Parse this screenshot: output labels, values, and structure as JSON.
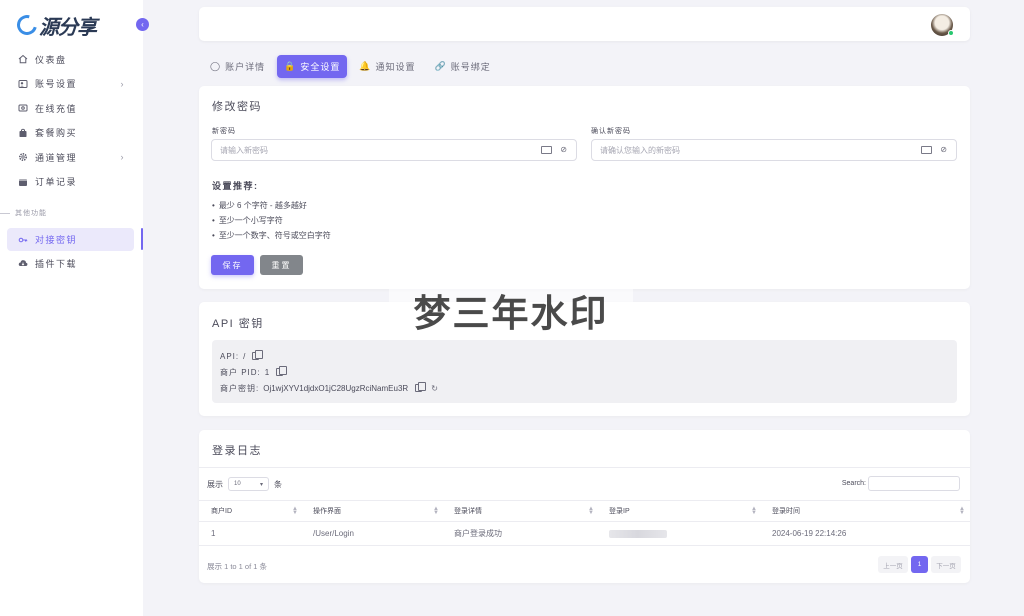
{
  "brand": {
    "logo_text": "源分享"
  },
  "sidebar": {
    "items": [
      {
        "label": "仪表盘",
        "icon": "home-icon"
      },
      {
        "label": "账号设置",
        "icon": "user-card-icon",
        "has_submenu": true
      },
      {
        "label": "在线充值",
        "icon": "wallet-icon"
      },
      {
        "label": "套餐购买",
        "icon": "shopping-icon"
      },
      {
        "label": "通道管理",
        "icon": "gear-icon",
        "has_submenu": true
      },
      {
        "label": "订单记录",
        "icon": "order-icon"
      }
    ],
    "section_label": "其他功能",
    "extra_items": [
      {
        "label": "对接密钥",
        "icon": "key-icon",
        "active": true
      },
      {
        "label": "插件下载",
        "icon": "cloud-download-icon"
      }
    ]
  },
  "tabs": [
    {
      "label": "账户详情",
      "icon": "user-icon"
    },
    {
      "label": "安全设置",
      "icon": "lock-icon",
      "active": true
    },
    {
      "label": "通知设置",
      "icon": "bell-icon"
    },
    {
      "label": "账号绑定",
      "icon": "link-icon"
    }
  ],
  "password": {
    "title": "修改密码",
    "new_label": "新密码",
    "new_placeholder": "请输入新密码",
    "confirm_label": "确认新密码",
    "confirm_placeholder": "请确认您输入的新密码",
    "rec_title": "设置推荐:",
    "recs": [
      "最少 6 个字符 - 越多越好",
      "至少一个小写字符",
      "至少一个数字、符号或空白字符"
    ],
    "save_label": "保存",
    "reset_label": "重置"
  },
  "api": {
    "title": "API 密钥",
    "api_key": "API:",
    "api_val": "/",
    "pid_key": "商户 PID:",
    "pid_val": "1",
    "secret_key": "商户密钥:",
    "secret_val": "Oj1wjXYV1djdxO1jC28UgzRciNamEu3R"
  },
  "log": {
    "title": "登录日志",
    "show_prefix": "展示",
    "page_size": "10",
    "show_suffix": "条",
    "search_label": "Search:",
    "columns": [
      "商户ID",
      "操作界面",
      "登录详情",
      "登录IP",
      "登录时间"
    ],
    "rows": [
      {
        "id": "1",
        "page": "/User/Login",
        "detail": "商户登录成功",
        "ip": "",
        "time": "2024-06-19 22:14:26"
      }
    ],
    "info": "展示 1 to 1 of 1 条",
    "prev": "上一页",
    "current_page": "1",
    "next": "下一页"
  },
  "watermark": "梦三年水印",
  "colors": {
    "accent": "#7367f0",
    "success": "#28c76f",
    "secondary": "#82868b"
  }
}
